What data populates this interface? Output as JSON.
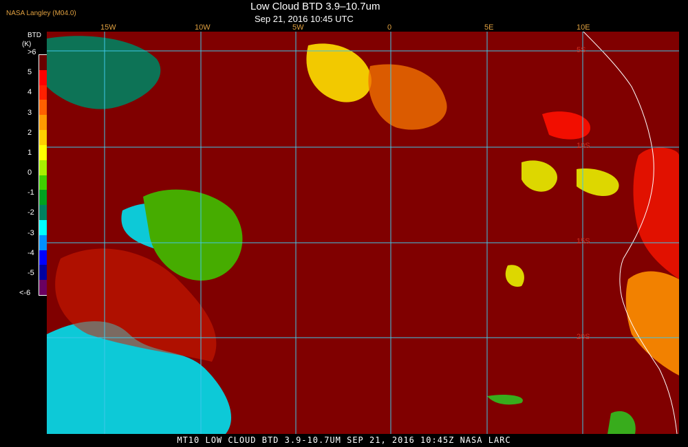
{
  "header": {
    "credit": "NASA Langley (M04.0)",
    "title": "Low Cloud BTD 3.9–10.7um",
    "subtitle": "Sep 21, 2016 10:45 UTC"
  },
  "legend": {
    "unit_line1": "BTD",
    "unit_line2": "(K)",
    "labels": [
      ">6",
      "5",
      "4",
      "3",
      "2",
      "1",
      "0",
      "-1",
      "-2",
      "-3",
      "-4",
      "-5",
      "<-6"
    ],
    "colors": [
      "#6a0000",
      "#ff0000",
      "#ff2000",
      "#ff6000",
      "#ff9a00",
      "#ffd000",
      "#ffff00",
      "#a8f000",
      "#40d000",
      "#00a020",
      "#008060",
      "#00ffff",
      "#0090ff",
      "#0000ff",
      "#0000a0",
      "#6a0060"
    ]
  },
  "map": {
    "background": "#800000",
    "grid_color": "#40c8e8",
    "lon_labels": [
      "15W",
      "10W",
      "5W",
      "0",
      "5E",
      "10E"
    ],
    "lat_labels": [
      "5S",
      "10S",
      "15S",
      "20S"
    ]
  },
  "footer": {
    "text": "MT10   LOW CLOUD BTD 3.9-10.7UM   SEP 21, 2016 10:45Z   NASA LARC"
  }
}
